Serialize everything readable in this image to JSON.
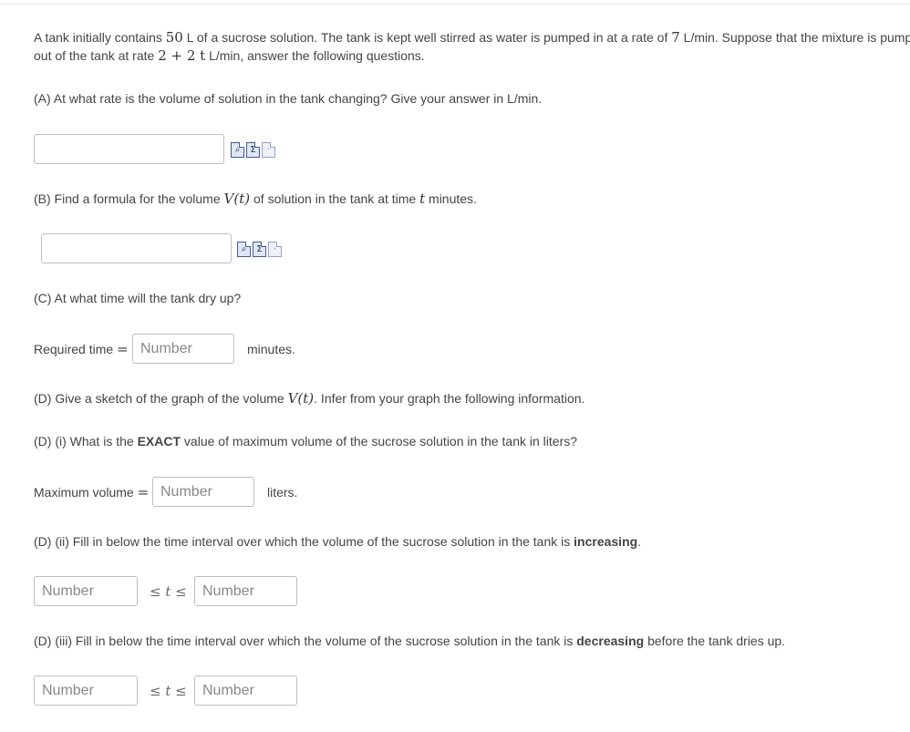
{
  "intro": {
    "line1_a": "A tank initially contains ",
    "initial_volume": "50",
    "line1_b": " L of a sucrose solution. The tank is kept well stirred as water is pumped in at a rate of ",
    "inflow_rate": "7",
    "line1_c": " L/min. Suppose that the mixture is pumped",
    "line2_a": "out of the tank at rate ",
    "outflow_rate": "2 + 2 t",
    "line2_b": " L/min, answer the following questions."
  },
  "part_a": {
    "question": "(A) At what rate is the volume of solution in the tank changing? Give your answer in L/min.",
    "answer_value": ""
  },
  "part_b": {
    "question_a": "(B) Find a formula for the volume ",
    "vt": "V(t)",
    "question_b": " of solution in the tank at time ",
    "t": "t",
    "question_c": " minutes.",
    "answer_value": ""
  },
  "part_c": {
    "question": "(C) At what time will the tank dry up?",
    "label": "Required time",
    "eq": "=",
    "placeholder": "Number",
    "unit": "minutes."
  },
  "part_d": {
    "question_a": "(D) Give a sketch of the graph of the volume ",
    "vt": "V(t)",
    "question_b": ". Infer from your graph the following information.",
    "i_question_a": "(D) (i) What is the ",
    "i_question_bold": "EXACT",
    "i_question_b": " value of maximum volume of the sucrose solution in the tank in liters?",
    "i_label": "Maximum volume",
    "i_eq": "=",
    "i_placeholder": "Number",
    "i_unit": "liters.",
    "ii_question_a": "(D) (ii) Fill in below the time interval over which the volume of the sucrose solution in the tank is ",
    "ii_question_bold": "increasing",
    "ii_question_b": ".",
    "ii_left_placeholder": "Number",
    "ii_ineq": "≤ t ≤",
    "ii_right_placeholder": "Number",
    "iii_question_a": "(D) (iii) Fill in below the time interval over which the volume of the sucrose solution in the tank is ",
    "iii_question_bold": "decreasing",
    "iii_question_b": " before the tank dries up.",
    "iii_left_placeholder": "Number",
    "iii_ineq": "≤ t ≤",
    "iii_right_placeholder": "Number"
  },
  "icons": {
    "tool_1": "preview-icon",
    "tool_2": "formula-sigma-icon",
    "tool_3": "help-page-icon",
    "sigma_glyph": "Σ",
    "preview_glyph": "⌕",
    "page_glyph": "·"
  }
}
